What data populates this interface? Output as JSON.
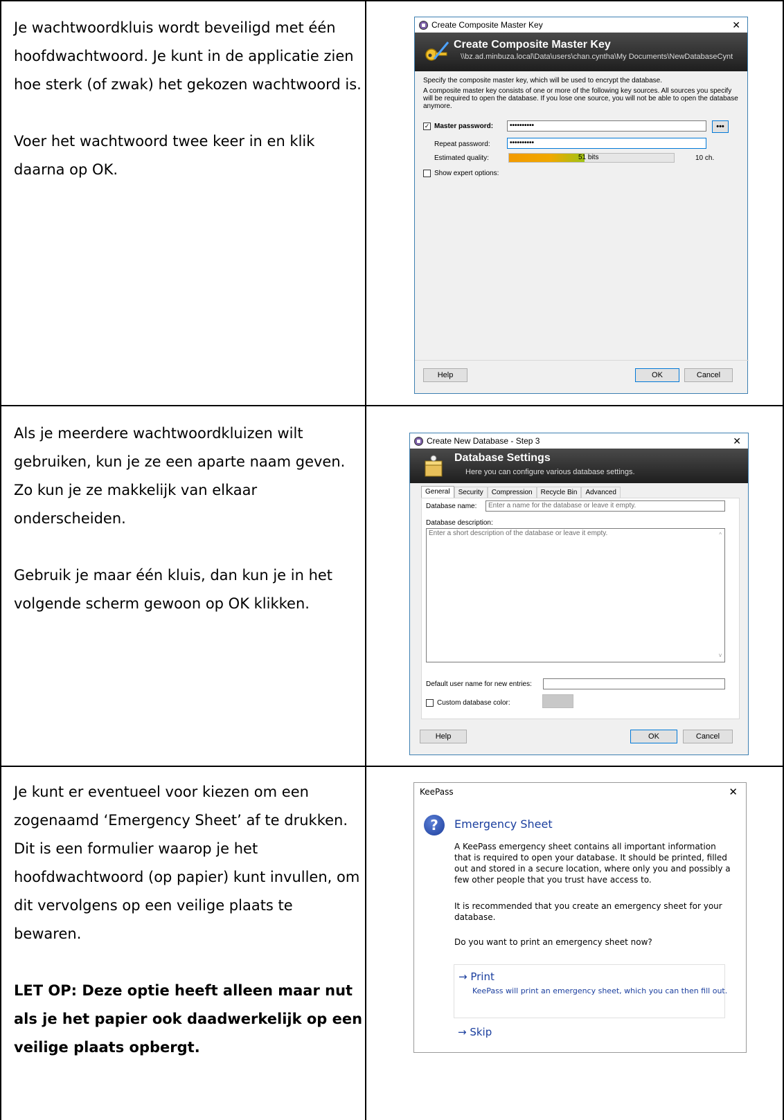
{
  "rows": [
    {
      "paragraphs": [
        "Je wachtwoordkluis wordt beveiligd met één hoofdwachtwoord. Je kunt in de applicatie zien hoe sterk (of zwak) het gekozen wachtwoord is.",
        "Voer het wachtwoord twee keer in en klik daarna op OK."
      ]
    },
    {
      "paragraphs": [
        "Als je meerdere wachtwoordkluizen wilt gebruiken, kun je ze een aparte naam geven. Zo kun je ze makkelijk van elkaar onderscheiden.",
        "Gebruik je maar één kluis, dan kun je in het volgende scherm gewoon op OK klikken."
      ]
    },
    {
      "paragraphs": [
        "Je kunt er eventueel voor kiezen om een zogenaamd ‘Emergency Sheet’ af te drukken. Dit is een formulier waarop je het hoofdwachtwoord (op papier) kunt invullen, om dit vervolgens op een veilige plaats te bewaren."
      ],
      "warning": "LET OP: Deze optie heeft alleen maar nut als je het papier ook daadwerkelijk op een veilige plaats opbergt."
    }
  ],
  "dialog1": {
    "window_title": "Create Composite Master Key",
    "banner_title": "Create Composite Master Key",
    "banner_path": "\\\\bz.ad.minbuza.local\\Data\\users\\chan.cyntha\\My Documents\\NewDatabaseCynt",
    "intro": "Specify the composite master key, which will be used to encrypt the database.",
    "desc": "A composite master key consists of one or more of the following key sources. All sources you specify will be required to open the database. If you lose one source, you will not be able to open the database anymore.",
    "master_label": "Master password:",
    "master_value": "••••••••••",
    "repeat_label": "Repeat password:",
    "repeat_value": "••••••••••",
    "quality_label": "Estimated quality:",
    "quality_bits": "51 bits",
    "quality_fraction": 0.46,
    "quality_chars": "10 ch.",
    "dots_button": "•••",
    "expert_label": "Show expert options:",
    "help": "Help",
    "ok": "OK",
    "cancel": "Cancel"
  },
  "dialog2": {
    "window_title": "Create New Database - Step 3",
    "banner_title": "Database Settings",
    "banner_sub": "Here you can configure various database settings.",
    "tabs": [
      "General",
      "Security",
      "Compression",
      "Recycle Bin",
      "Advanced"
    ],
    "name_label": "Database name:",
    "name_placeholder": "Enter a name for the database or leave it empty.",
    "desc_label": "Database description:",
    "desc_placeholder": "Enter a short description of the database or leave it empty.",
    "username_label": "Default user name for new entries:",
    "color_label": "Custom database color:",
    "help": "Help",
    "ok": "OK",
    "cancel": "Cancel"
  },
  "dialog3": {
    "window_title": "KeePass",
    "heading": "Emergency Sheet",
    "body1": "A KeePass emergency sheet contains all important information that is required to open your database. It should be printed, filled out and stored in a secure location, where only you and possibly a few other people that you trust have access to.",
    "body2": "It is recommended that you create an emergency sheet for your database.",
    "question": "Do you want to print an emergency sheet now?",
    "print": "→ Print",
    "print_sub": "KeePass will print an emergency sheet, which you can then fill out.",
    "skip": "→ Skip"
  },
  "colors": {
    "banner": "#2a2a2a",
    "accent_blue": "#1a3e9e",
    "quality_orange": "#f39a00",
    "quality_green": "#9fc316"
  },
  "icons": [
    "lock-icon",
    "key-icon",
    "database-icon",
    "question-icon",
    "close-icon",
    "check-icon",
    "arrow-right-icon"
  ]
}
